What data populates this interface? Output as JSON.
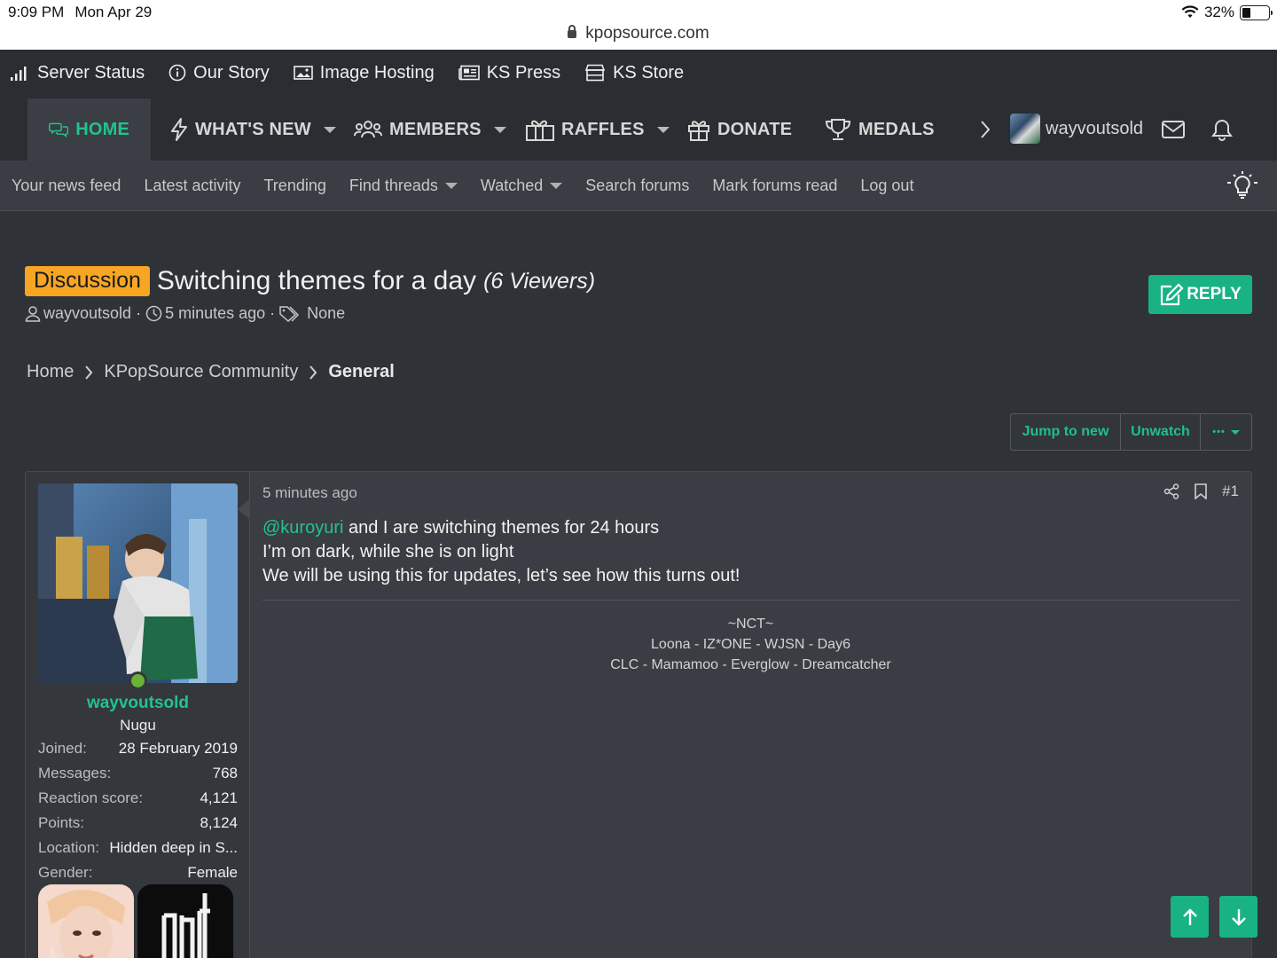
{
  "status": {
    "time": "9:09 PM",
    "date": "Mon Apr 29",
    "url": "kpopsource.com",
    "battery": "32%"
  },
  "topbar": [
    "Server Status",
    "Our Story",
    "Image Hosting",
    "KS Press",
    "KS Store"
  ],
  "nav": {
    "home": "HOME",
    "whats_new": "WHAT'S NEW",
    "members": "MEMBERS",
    "raffles": "RAFFLES",
    "donate": "DONATE",
    "medals": "MEDALS",
    "username": "wayvoutsold"
  },
  "subnav": [
    "Your news feed",
    "Latest activity",
    "Trending",
    "Find threads",
    "Watched",
    "Search forums",
    "Mark forums read",
    "Log out"
  ],
  "thread": {
    "prefix": "Discussion",
    "title": "Switching themes for a day",
    "viewers": "(6 Viewers)",
    "author": "wayvoutsold",
    "age": "5 minutes ago",
    "tags": "None",
    "reply": "REPLY"
  },
  "breadcrumb": {
    "home": "Home",
    "community": "KPopSource Community",
    "current": "General"
  },
  "actions": {
    "jump": "Jump to new",
    "unwatch": "Unwatch",
    "more": "•••"
  },
  "post": {
    "time": "5 minutes ago",
    "number": "#1",
    "mention": "@kuroyuri",
    "line1_rest": " and I are switching themes for 24 hours",
    "line2": "I’m on dark, while she is on light",
    "line3": "We will be using this for updates, let’s see how this turns out!",
    "sig1": "~NCT~",
    "sig2": "Loona - IZ*ONE - WJSN - Day6",
    "sig3": "CLC - Mamamoo - Everglow - Dreamcatcher"
  },
  "user": {
    "name": "wayvoutsold",
    "title": "Nugu",
    "stats": [
      {
        "k": "Joined:",
        "v": "28 February 2019"
      },
      {
        "k": "Messages:",
        "v": "768"
      },
      {
        "k": "Reaction score:",
        "v": "4,121"
      },
      {
        "k": "Points:",
        "v": "8,124"
      },
      {
        "k": "Location:",
        "v": "Hidden deep in S..."
      },
      {
        "k": "Gender:",
        "v": "Female"
      }
    ]
  },
  "colors": {
    "accent": "#22c38e",
    "button": "#19b383",
    "prefix": "#f6a623"
  }
}
